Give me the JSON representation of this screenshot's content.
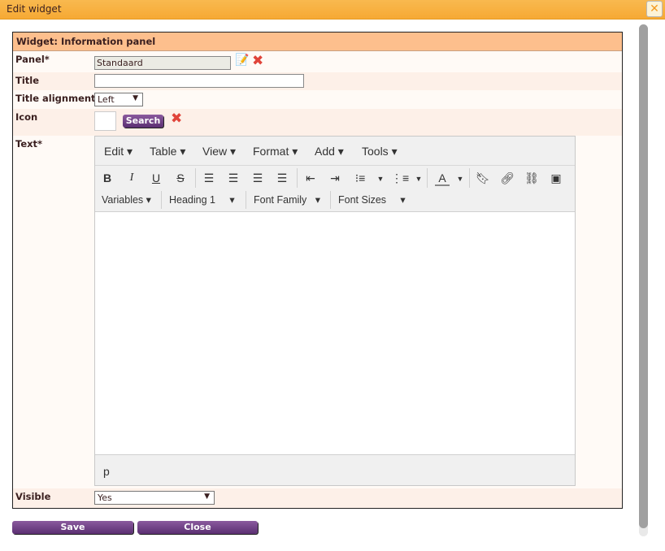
{
  "window": {
    "title": "Edit widget",
    "close_icon": "close-icon"
  },
  "panel_title": "Widget: Information panel",
  "fields": {
    "panel": {
      "label": "Panel*",
      "value": "Standaard"
    },
    "title": {
      "label": "Title",
      "value": ""
    },
    "title_alignment": {
      "label": "Title alignment",
      "value": "Left"
    },
    "icon": {
      "label": "Icon",
      "search_label": "Search"
    },
    "text": {
      "label": "Text*"
    },
    "visible": {
      "label": "Visible",
      "value": "Yes"
    }
  },
  "editor": {
    "menus": [
      "Edit",
      "Table",
      "View",
      "Format",
      "Add",
      "Tools"
    ],
    "dropdowns": [
      "Variables",
      "Heading 1",
      "Font Family",
      "Font Sizes"
    ],
    "status_path": "p"
  },
  "buttons": {
    "save": "Save",
    "close": "Close"
  },
  "colors": {
    "titlebar": "#f6a934",
    "header": "#fdbf8d",
    "button": "#5b2f72",
    "delete": "#e0443a"
  }
}
